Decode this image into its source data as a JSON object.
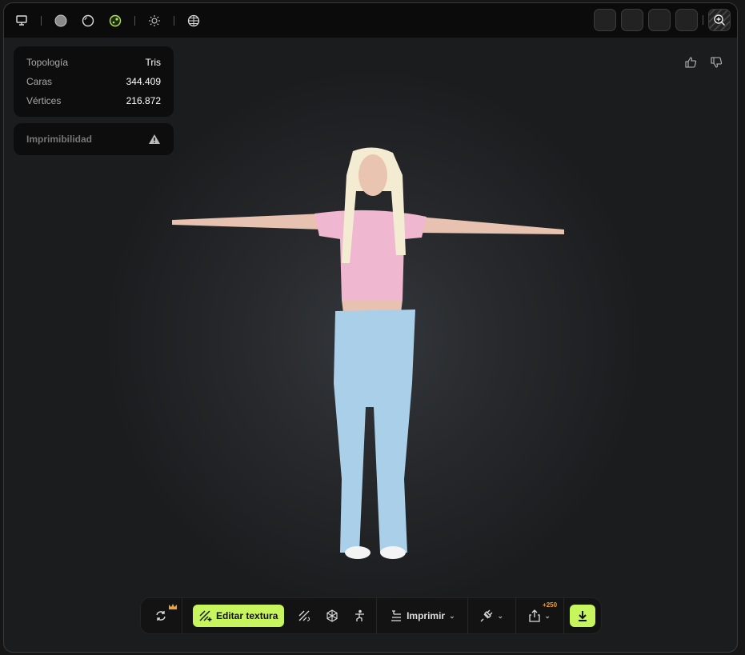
{
  "stats": {
    "rows": [
      {
        "label": "Topología",
        "value": "Tris"
      },
      {
        "label": "Caras",
        "value": "344.409"
      },
      {
        "label": "Vértices",
        "value": "216.872"
      }
    ]
  },
  "printability": {
    "label": "Imprimibilidad"
  },
  "toolbar": {
    "edit_texture": "Editar textura",
    "print": "Imprimir",
    "share_badge": "+250"
  },
  "colors": {
    "accent": "#c6f55d",
    "crown": "#e8a33a"
  }
}
